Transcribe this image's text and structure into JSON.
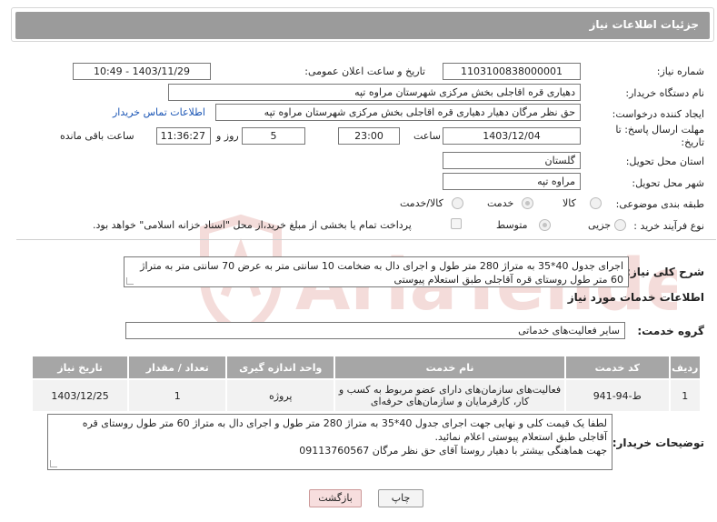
{
  "header": {
    "title": "جزئیات اطلاعات نیاز"
  },
  "labels": {
    "need_number": "شماره نیاز:",
    "announce_datetime": "تاریخ و ساعت اعلان عمومی:",
    "buyer_org": "نام دستگاه خریدار:",
    "requester": "ایجاد کننده درخواست:",
    "deadline": "مهلت ارسال پاسخ: تا تاریخ:",
    "time_word": "ساعت",
    "day_and": "روز و",
    "time_remaining": "ساعت باقی مانده",
    "province": "استان محل تحویل:",
    "city": "شهر محل تحویل:",
    "category": "طبقه بندی موضوعی:",
    "process_type": "نوع فرآیند خرید :",
    "general_description": "شرح کلی نیاز:",
    "services_info": "اطلاعات خدمات مورد نیاز",
    "service_group": "گروه خدمت:",
    "buyer_notes": "توضیحات خریدار:"
  },
  "fields": {
    "need_number": "1103100838000001",
    "announce_datetime": "1403/11/29 - 10:49",
    "buyer_org": "دهیاری قره اقاجلی بخش مرکزی شهرستان مراوه تپه",
    "requester": "حق نظر مرگان دهیار دهیاری قره اقاجلی بخش مرکزی شهرستان مراوه تپه",
    "contact_link": "اطلاعات تماس خریدار",
    "deadline_date": "1403/12/04",
    "deadline_time": "23:00",
    "days": "5",
    "remaining_time": "11:36:27",
    "province": "گلستان",
    "city": "مراوه تپه",
    "general_description": "اجرای جدول 40*35 به متراژ 280 متر طول و اجرای دال به ضخامت 10 سانتی متر به عرض 70 سانتی متر به متراژ 60 متر طول روستای قره آقاجلی طبق استعلام پیوستی",
    "service_group": "سایر فعالیت‌های خدماتی",
    "buyer_notes_line1": "لطفا یک قیمت کلی و نهایی جهت اجرای جدول 40*35 به متراژ 280 متر طول و اجرای دال  به متراژ 60 متر طول روستای قره آقاجلی طبق استعلام پیوستی اعلام نمائید.",
    "buyer_notes_line2": "جهت هماهنگی بیشتر با دهیار روستا آقای حق نظر مرگان 09113760567"
  },
  "category_options": [
    {
      "label": "کالا",
      "checked": false
    },
    {
      "label": "خدمت",
      "checked": true
    },
    {
      "label": "کالا/خدمت",
      "checked": false
    }
  ],
  "process_options": [
    {
      "label": "جزیی",
      "checked": false
    },
    {
      "label": "متوسط",
      "checked": true
    }
  ],
  "payment_note": "پرداخت تمام یا بخشی از مبلغ خرید،از محل \"اسناد خزانه اسلامی\" خواهد بود.",
  "table": {
    "headers": [
      "ردیف",
      "کد خدمت",
      "نام خدمت",
      "واحد اندازه گیری",
      "تعداد / مقدار",
      "تاریخ نیاز"
    ],
    "rows": [
      [
        "1",
        "ط-94-941",
        "فعالیت‌های سازمان‌های دارای عضو مربوط به کسب و کار، کارفرمایان و سازمان‌های حرفه‌ای",
        "پروژه",
        "1",
        "1403/12/25"
      ]
    ]
  },
  "buttons": {
    "print": "چاپ",
    "back": "بازگشت"
  },
  "watermark": {
    "text": "AriaTender.neT"
  },
  "colors": {
    "header_bg": "#9b9b9b",
    "table_header_bg": "#a6a6a6",
    "link": "#1a55b5",
    "back_button_bg": "#f7dede",
    "watermark": "#c0392b"
  }
}
